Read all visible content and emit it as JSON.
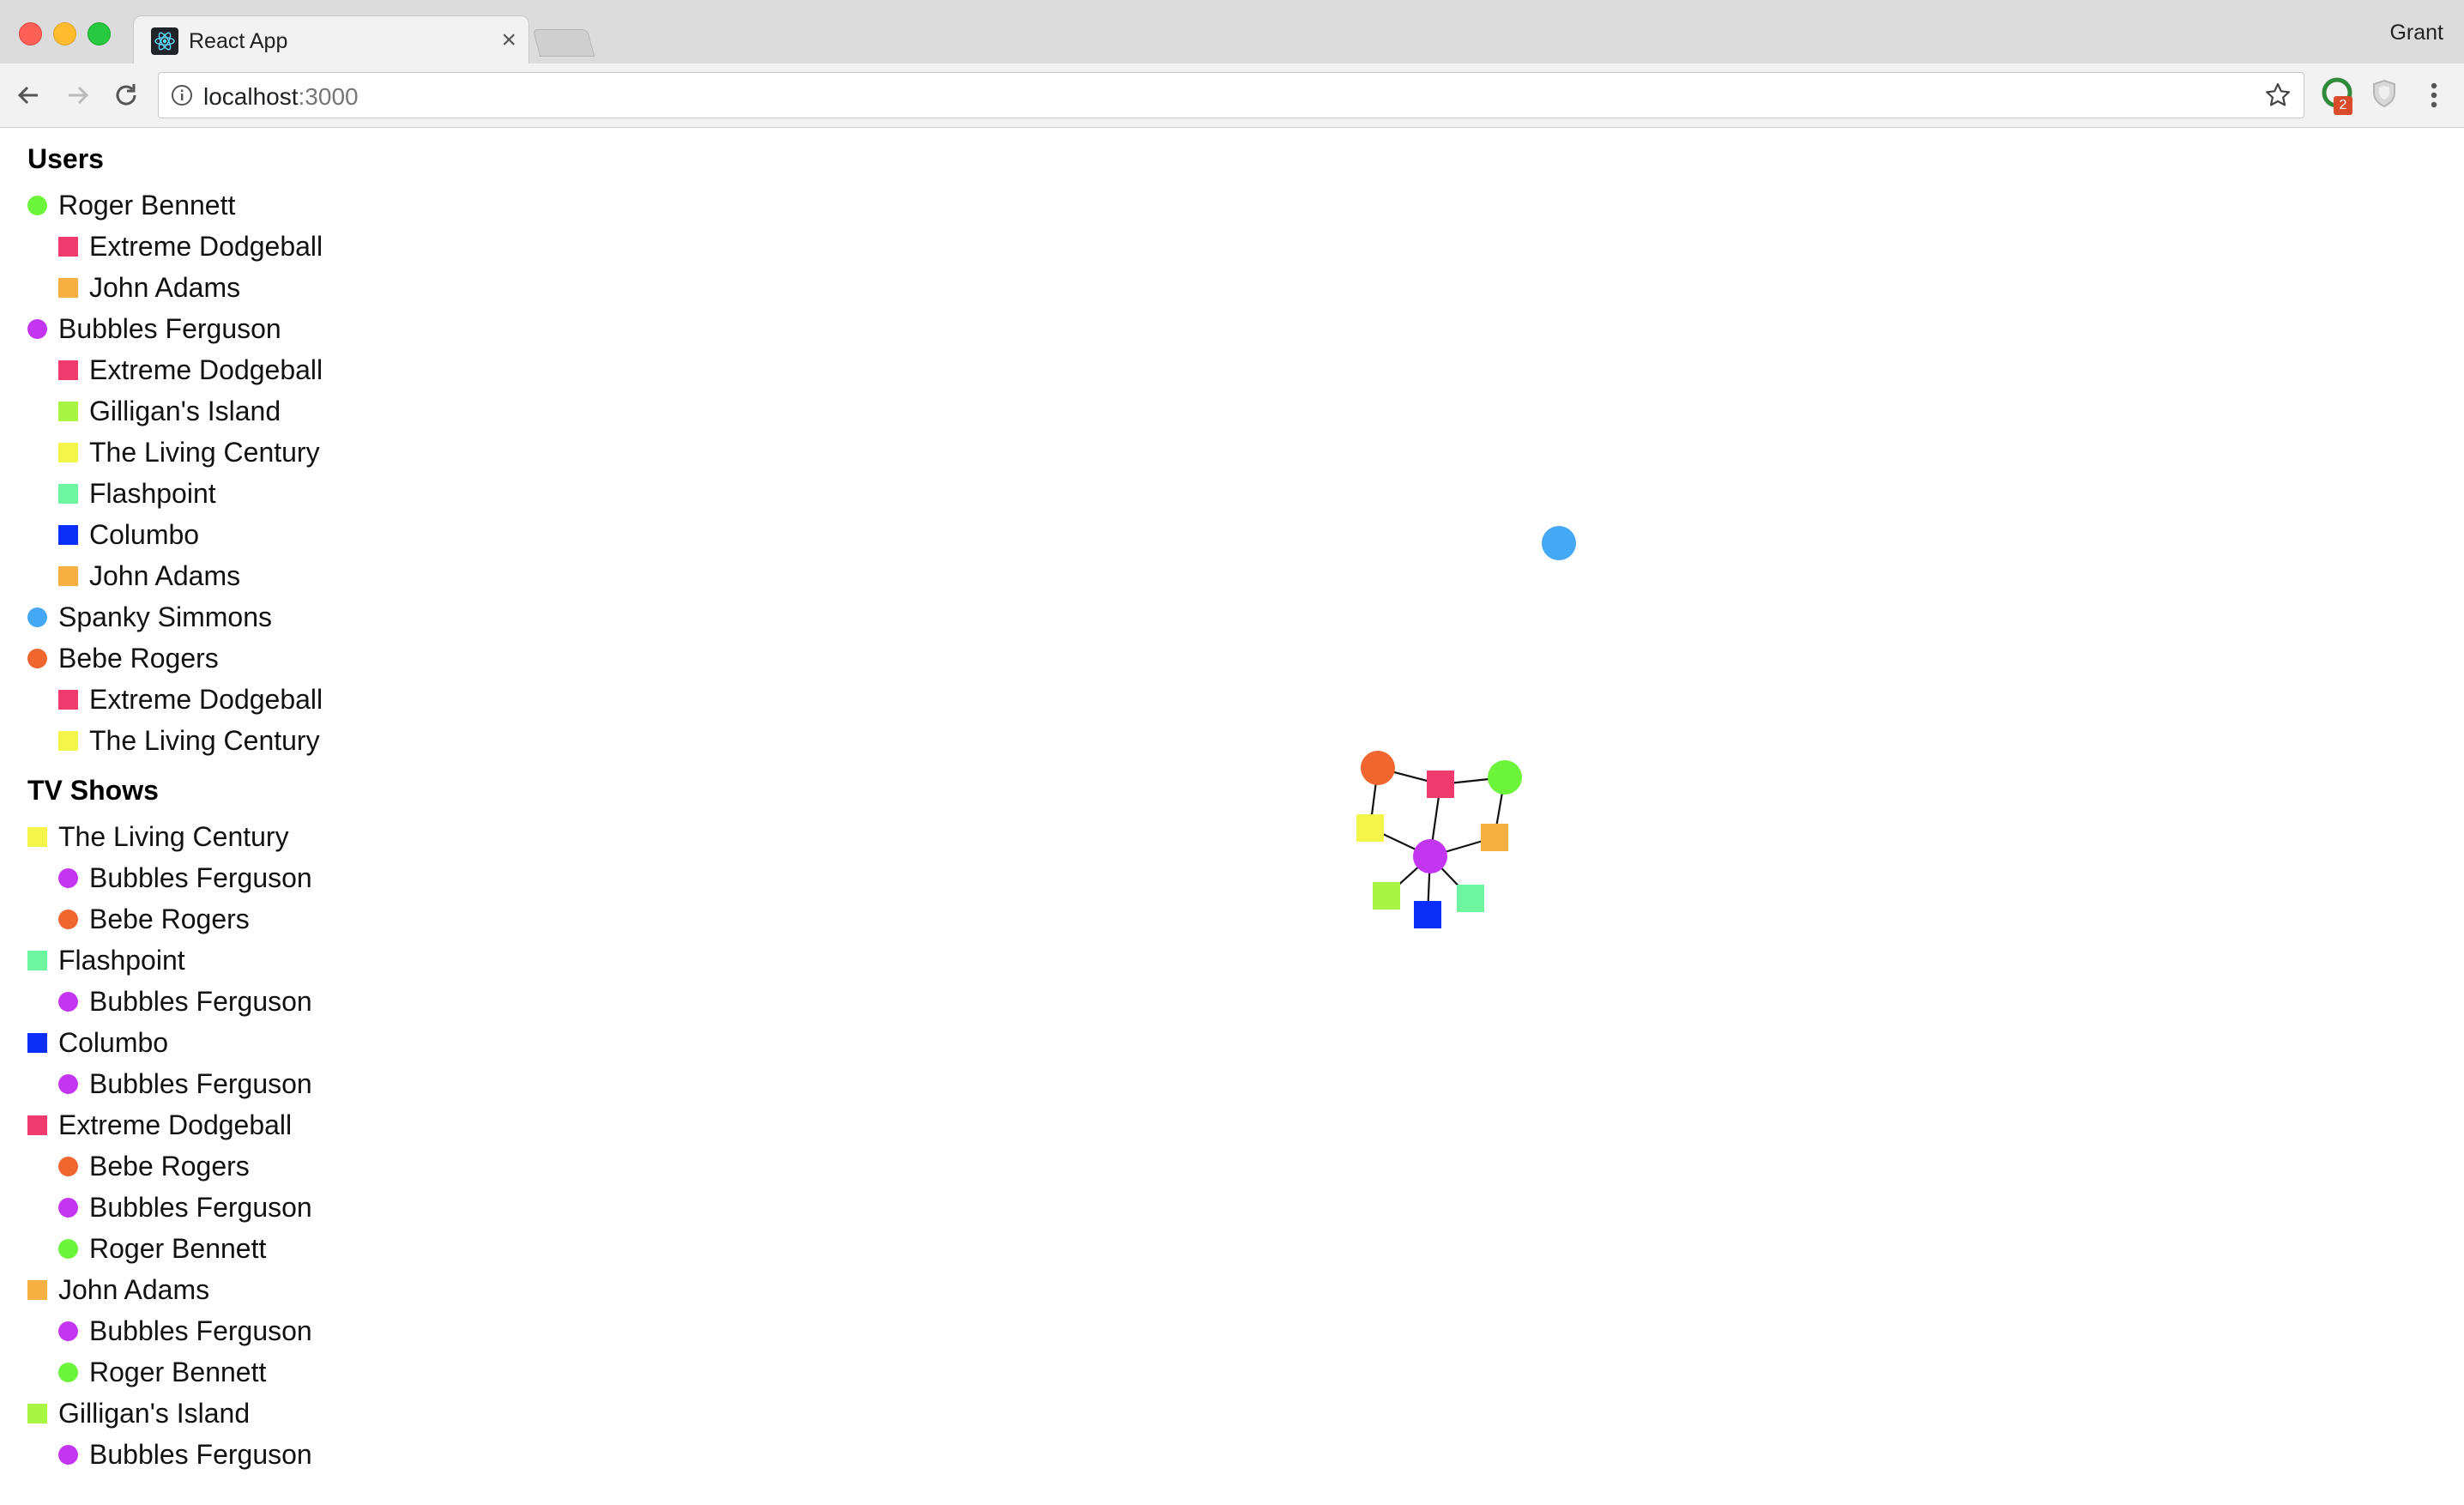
{
  "browser": {
    "tab_title": "React App",
    "tab_close": "×",
    "profile_name": "Grant",
    "url_host": "localhost",
    "url_port": ":3000",
    "extension_badge": "2"
  },
  "colors": {
    "Roger Bennett": "#6df53b",
    "Bubbles Ferguson": "#c236f2",
    "Spanky Simmons": "#45a8f5",
    "Bebe Rogers": "#f0662e",
    "Extreme Dodgeball": "#ef3a6d",
    "John Adams": "#f5b041",
    "Gilligan's Island": "#a8f542",
    "The Living Century": "#f3f54a",
    "Flashpoint": "#6ef5a0",
    "Columbo": "#0a2ef5"
  },
  "users_section": {
    "title": "Users",
    "items": [
      {
        "name": "Roger Bennett",
        "shows": [
          "Extreme Dodgeball",
          "John Adams"
        ]
      },
      {
        "name": "Bubbles Ferguson",
        "shows": [
          "Extreme Dodgeball",
          "Gilligan's Island",
          "The Living Century",
          "Flashpoint",
          "Columbo",
          "John Adams"
        ]
      },
      {
        "name": "Spanky Simmons",
        "shows": []
      },
      {
        "name": "Bebe Rogers",
        "shows": [
          "Extreme Dodgeball",
          "The Living Century"
        ]
      }
    ]
  },
  "shows_section": {
    "title": "TV Shows",
    "items": [
      {
        "name": "The Living Century",
        "users": [
          "Bubbles Ferguson",
          "Bebe Rogers"
        ]
      },
      {
        "name": "Flashpoint",
        "users": [
          "Bubbles Ferguson"
        ]
      },
      {
        "name": "Columbo",
        "users": [
          "Bubbles Ferguson"
        ]
      },
      {
        "name": "Extreme Dodgeball",
        "users": [
          "Bebe Rogers",
          "Bubbles Ferguson",
          "Roger Bennett"
        ]
      },
      {
        "name": "John Adams",
        "users": [
          "Bubbles Ferguson",
          "Roger Bennett"
        ]
      },
      {
        "name": "Gilligan's Island",
        "users": [
          "Bubbles Ferguson"
        ]
      }
    ]
  },
  "graph": {
    "edges": [
      [
        "Bebe Rogers",
        "Extreme Dodgeball"
      ],
      [
        "Bebe Rogers",
        "The Living Century"
      ],
      [
        "Extreme Dodgeball",
        "Roger Bennett"
      ],
      [
        "Extreme Dodgeball",
        "Bubbles Ferguson"
      ],
      [
        "Roger Bennett",
        "John Adams"
      ],
      [
        "Bubbles Ferguson",
        "The Living Century"
      ],
      [
        "Bubbles Ferguson",
        "John Adams"
      ],
      [
        "Bubbles Ferguson",
        "Gilligan's Island"
      ],
      [
        "Bubbles Ferguson",
        "Columbo"
      ],
      [
        "Bubbles Ferguson",
        "Flashpoint"
      ]
    ]
  }
}
